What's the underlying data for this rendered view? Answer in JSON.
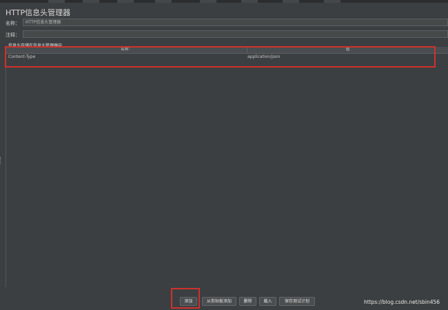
{
  "panel": {
    "title": "HTTP信息头管理器",
    "name_label": "名称：",
    "name_value": "HTTP信息头管理器",
    "comment_label": "注释：",
    "comment_value": "",
    "section_title": "信息头存储在信息头管理器中"
  },
  "table": {
    "columns": [
      "名称：",
      "值"
    ],
    "rows": [
      {
        "name": "Content-Type",
        "value": "application/json"
      }
    ]
  },
  "buttons": {
    "add": "添加",
    "add_from_clipboard": "从剪贴板添加",
    "delete": "删除",
    "load": "载入",
    "save_test_plan": "保存测试计划"
  },
  "watermark": "https://blog.csdn.net/sbin456",
  "colors": {
    "background": "#3c3f41",
    "highlight": "#d0312d"
  }
}
